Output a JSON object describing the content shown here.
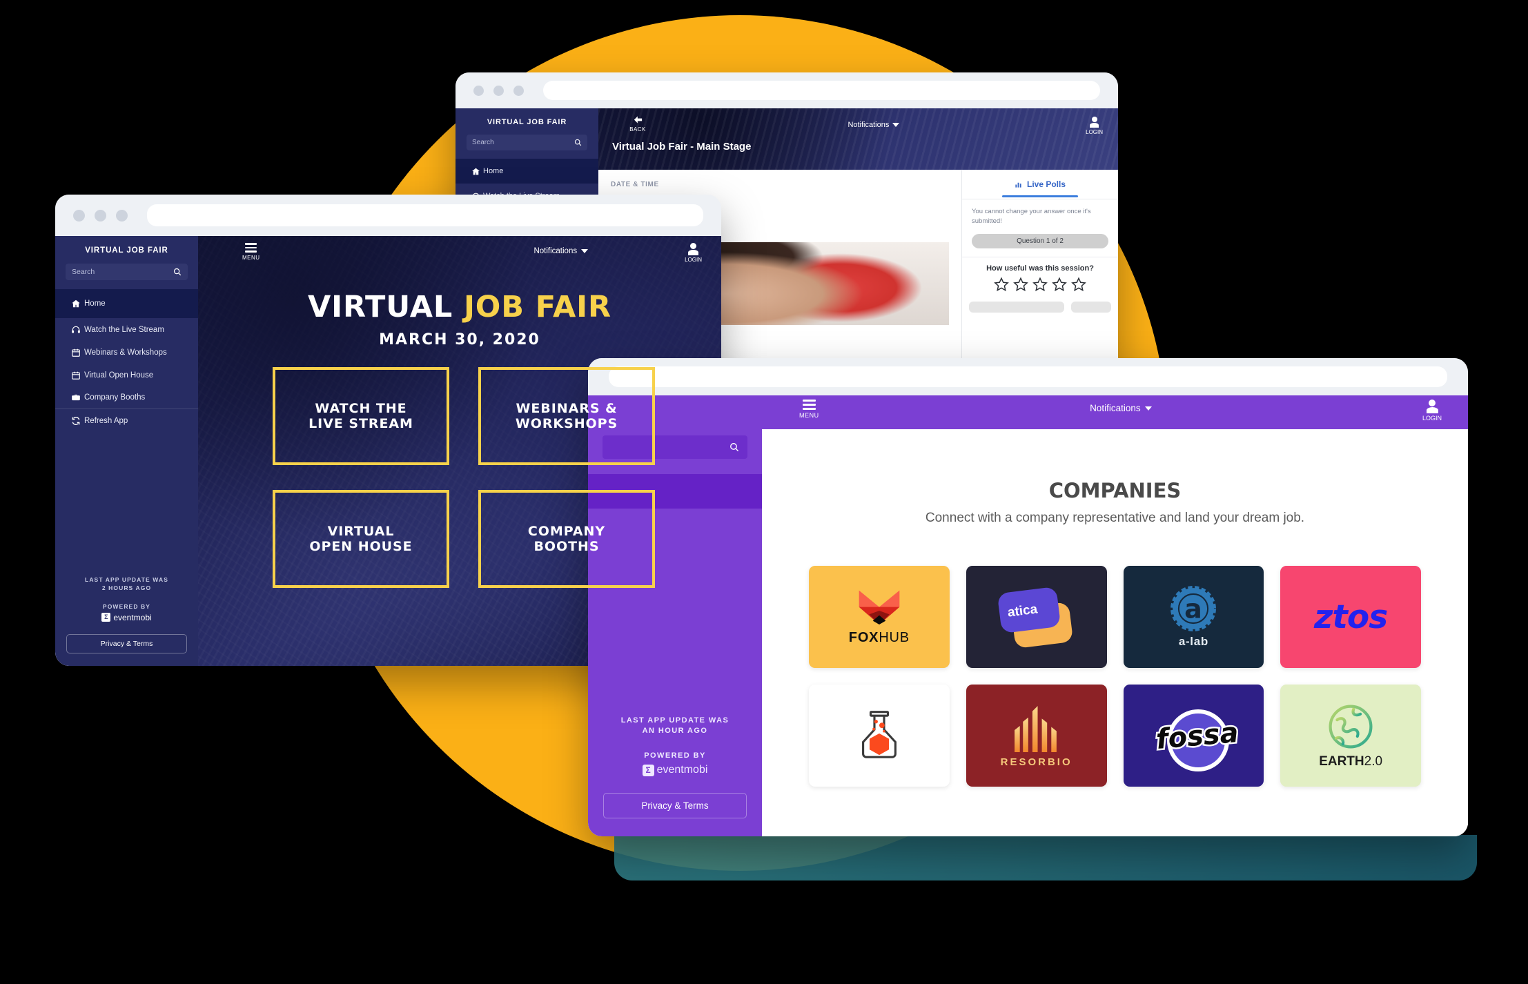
{
  "theme": {
    "yellow_circle": "#FBB016",
    "navy": "#272C63",
    "navy_dark": "#141B4D",
    "accent_yellow": "#F7D14B",
    "purple": "#7B3FD3",
    "poll_blue": "#3B7DDD"
  },
  "window1": {
    "name": "virtual-job-fair-home",
    "sidebar": {
      "title": "VIRTUAL JOB FAIR",
      "search_placeholder": "Search",
      "search_icon": "search-icon",
      "items": [
        {
          "label": "Home",
          "icon": "home-icon",
          "active": true
        },
        {
          "label": "Watch the Live Stream",
          "icon": "headphones-icon",
          "active": false
        },
        {
          "label": "Webinars & Workshops",
          "icon": "calendar-icon",
          "active": false
        },
        {
          "label": "Virtual Open House",
          "icon": "calendar-icon",
          "active": false
        },
        {
          "label": "Company Booths",
          "icon": "briefcase-icon",
          "active": false
        },
        {
          "label": "Refresh App",
          "icon": "refresh-icon",
          "active": false
        }
      ],
      "update_line1": "LAST APP UPDATE WAS",
      "update_line2": "2 HOURS AGO",
      "powered_by": "POWERED BY",
      "brand": "eventmobi",
      "privacy": "Privacy & Terms"
    },
    "topbar": {
      "menu_label": "MENU",
      "menu_icon": "hamburger-icon",
      "notifications": "Notifications",
      "notifications_caret": "chevron-down-icon",
      "login_label": "LOGIN",
      "login_icon": "user-icon"
    },
    "hero": {
      "title_white": "VIRTUAL",
      "title_yellow": "JOB FAIR",
      "date": "MARCH 30, 2020",
      "tiles": [
        {
          "line1": "WATCH THE",
          "line2": "LIVE STREAM"
        },
        {
          "line1": "WEBINARS &",
          "line2": "WORKSHOPS"
        },
        {
          "line1": "VIRTUAL",
          "line2": "OPEN HOUSE"
        },
        {
          "line1": "COMPANY",
          "line2": "BOOTHS"
        }
      ]
    }
  },
  "window2": {
    "name": "main-stage",
    "sidebar": {
      "title": "VIRTUAL JOB FAIR",
      "search_placeholder": "Search",
      "items": [
        {
          "label": "Home",
          "icon": "home-icon",
          "active": true
        },
        {
          "label": "Watch the Live Stream",
          "icon": "headphones-icon",
          "active": false
        }
      ]
    },
    "header": {
      "back_label": "BACK",
      "back_icon": "arrow-left-icon",
      "notifications": "Notifications",
      "login_label": "LOGIN",
      "login_icon": "user-icon",
      "session_title": "Virtual Job Fair - Main Stage"
    },
    "detail": {
      "date_time_label": "DATE & TIME"
    },
    "polls": {
      "tab_label": "Live Polls",
      "tab_icon": "bar-chart-icon",
      "note": "You cannot change your answer once it's submitted!",
      "progress": "Question 1 of 2",
      "question": "How useful was this session?",
      "star_count": 5,
      "star_icon": "star-outline-icon"
    }
  },
  "window3": {
    "name": "companies",
    "sidebar": {
      "search_icon": "search-icon",
      "update_line1": "LAST APP UPDATE WAS",
      "update_line2": "AN HOUR AGO",
      "powered_by": "POWERED BY",
      "brand": "eventmobi",
      "privacy": "Privacy & Terms"
    },
    "topbar": {
      "menu_label": "MENU",
      "menu_icon": "hamburger-icon",
      "notifications": "Notifications",
      "notifications_caret": "chevron-down-icon",
      "login_label": "LOGIN",
      "login_icon": "user-icon"
    },
    "heading": "COMPANIES",
    "subheading": "Connect with a company representative and land your dream job.",
    "companies": [
      {
        "name": "FOXHUB",
        "cap_bold": "FOX",
        "cap_light": "HUB",
        "bg": "#FBC14C",
        "logo": "fox-icon",
        "text_color": "#111111"
      },
      {
        "name": "atica",
        "cap_bold": "atica",
        "cap_light": "",
        "bg": "#232336",
        "logo": "atica-icon",
        "text_color": "#FFFFFF"
      },
      {
        "name": "a-lab",
        "cap_bold": "",
        "cap_light": "a-lab",
        "bg": "#15293D",
        "logo": "a-lab-icon",
        "text_color": "#E6EDF3"
      },
      {
        "name": "ztos",
        "cap_bold": "ztos",
        "cap_light": "",
        "bg": "#F7466F",
        "logo": "ztos-icon",
        "text_color": "#2222EE"
      },
      {
        "name": "flask",
        "cap_bold": "",
        "cap_light": "",
        "bg": "#FFFFFF",
        "logo": "flask-icon",
        "text_color": "#333333"
      },
      {
        "name": "RESORBIO",
        "cap_bold": "RESORBIO",
        "cap_light": "",
        "bg": "#8C2226",
        "logo": "towers-icon",
        "text_color": "#F4C77A"
      },
      {
        "name": "fossa",
        "cap_bold": "fossa",
        "cap_light": "",
        "bg": "#2E1F86",
        "logo": "fossa-icon",
        "text_color": "#FFFFFF"
      },
      {
        "name": "EARTH2.0",
        "cap_bold": "EARTH",
        "cap_light": "2.0",
        "bg": "#E2EFC4",
        "logo": "earth-icon",
        "text_color": "#1D1D1D"
      }
    ]
  }
}
